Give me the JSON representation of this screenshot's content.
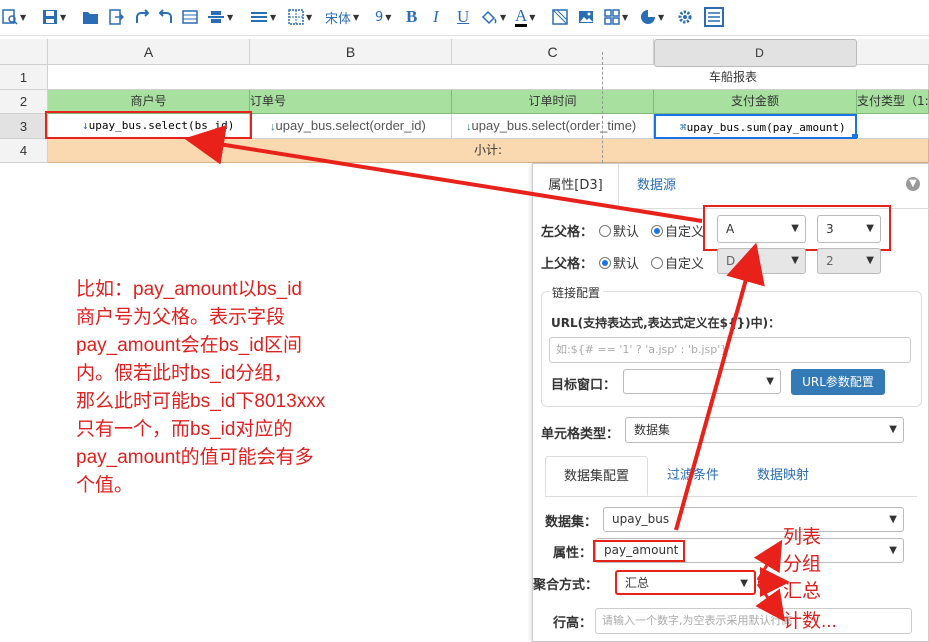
{
  "toolbar": {
    "font_name": "宋体",
    "font_size": "9",
    "bold": "B",
    "italic": "I",
    "underline": "U",
    "font_color": "A",
    "icons": [
      "preview-icon",
      "save-icon",
      "open-folder-icon",
      "export-icon",
      "redo-icon",
      "undo-icon",
      "merge-icon",
      "align-icon",
      "line-icon",
      "border-icon",
      "bold-icon",
      "italic-icon",
      "underline-icon",
      "paint-icon",
      "font-color-icon",
      "crop-icon",
      "image-icon",
      "grid-icon",
      "chart-icon",
      "settings-icon",
      "table-icon"
    ]
  },
  "sheet": {
    "columns": [
      "A",
      "B",
      "C",
      "D"
    ],
    "rows": [
      "1",
      "2",
      "3",
      "4"
    ],
    "title": "车船报表",
    "headers": [
      "商户号",
      "订单号",
      "订单时间",
      "支付金额",
      "支付类型（1:"
    ],
    "exprs": [
      "upay_bus.select(bs_id)",
      "upay_bus.select(order_id)",
      "upay_bus.select(order_time)",
      "upay_bus.sum(pay_amount)"
    ],
    "subtotal": "小计:"
  },
  "annotation": {
    "lines": [
      "比如：pay_amount以bs_id",
      "商户号为父格。表示字段",
      "pay_amount会在bs_id区间",
      "内。假若此时bs_id分组，",
      "那么此时可能bs_id下8013xxx",
      "只有一个，而bs_id对应的",
      "pay_amount的值可能会有多",
      "个值。"
    ],
    "options": [
      "列表",
      "分组",
      "汇总",
      "计数..."
    ]
  },
  "panel": {
    "tabs": [
      "属性[D3]",
      "数据源"
    ],
    "left_parent_label": "左父格：",
    "left_parent_opts": [
      "默认",
      "自定义"
    ],
    "left_parent_col": "A",
    "left_parent_row": "3",
    "top_parent_label": "上父格：",
    "top_parent_opts": [
      "默认",
      "自定义"
    ],
    "top_parent_col": "D",
    "top_parent_row": "2",
    "link_section": "链接配置",
    "url_label": "URL(支持表达式,表达式定义在${})中)：",
    "url_placeholder": "如:${# == '1' ? 'a.jsp' : 'b.jsp'}",
    "target_label": "目标窗口：",
    "url_param_button": "URL参数配置",
    "cell_type_label": "单元格类型：",
    "cell_type_value": "数据集",
    "subtabs": [
      "数据集配置",
      "过滤条件",
      "数据映射"
    ],
    "dataset_label": "数据集：",
    "dataset_value": "upay_bus",
    "attr_label": "属性：",
    "attr_value": "pay_amount",
    "agg_label": "聚合方式：",
    "agg_value": "汇总",
    "row_height_label": "行高：",
    "row_height_placeholder": "请输入一个数字,为空表示采用默认行高",
    "accent": "#337ab7"
  }
}
